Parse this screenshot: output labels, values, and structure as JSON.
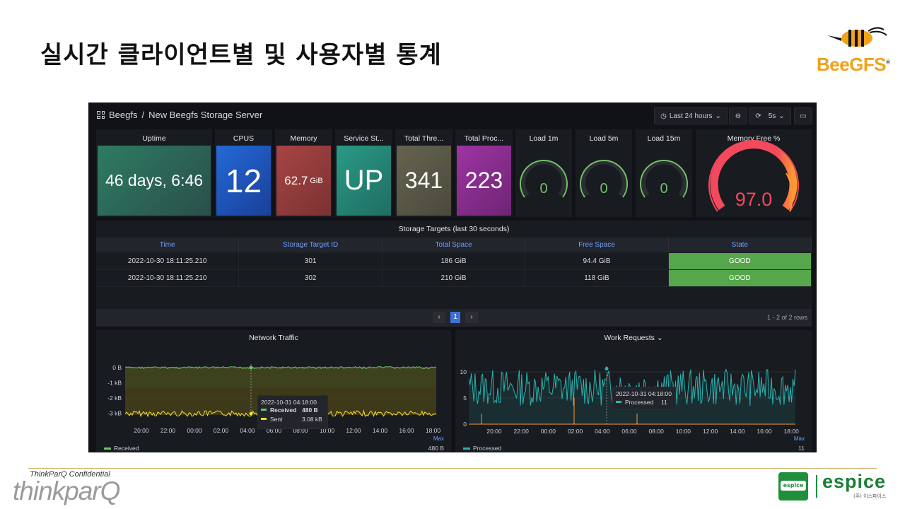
{
  "slide": {
    "title": "실시간 클라이언트별 및 사용자별 통계",
    "brand": "BeeGFS",
    "confidential": "ThinkParQ Confidential",
    "footer_logo": "thinkparQ",
    "partner_badge": "espice",
    "partner_name": "espice",
    "partner_sub": "(주) 이스파이스"
  },
  "dashboard": {
    "breadcrumb_root": "Beegfs",
    "breadcrumb_sep": "/",
    "breadcrumb_page": "New Beegfs Storage Server",
    "time_range": "Last 24 hours",
    "refresh": "5s",
    "icons": [
      "grid-icon",
      "clock-icon",
      "zoom-out-icon",
      "refresh-icon",
      "tv-icon"
    ]
  },
  "stats": [
    {
      "title": "Uptime",
      "value": "46 days, 6:46",
      "color": "#2d6a55"
    },
    {
      "title": "CPUS",
      "value": "12",
      "color": "#1f60c4"
    },
    {
      "title": "Memory",
      "value": "62.7",
      "unit": "GiB",
      "color": "#9a3a3a"
    },
    {
      "title": "Service St...",
      "value": "UP",
      "color": "#248a7a"
    },
    {
      "title": "Total Thre...",
      "value": "341",
      "color": "#5c5a4c"
    },
    {
      "title": "Total Proc...",
      "value": "223",
      "color": "#8e2e93"
    }
  ],
  "gauges": [
    {
      "title": "Load 1m",
      "value": "0",
      "fraction": 0
    },
    {
      "title": "Load 5m",
      "value": "0",
      "fraction": 0
    },
    {
      "title": "Load 15m",
      "value": "0",
      "fraction": 0
    },
    {
      "title": "Memory Free %",
      "value": "97.0",
      "fraction": 0.97
    }
  ],
  "storage_table": {
    "title": "Storage Targets (last 30 seconds)",
    "columns": [
      "Time",
      "Storage Target ID",
      "Total Space",
      "Free Space",
      "State"
    ],
    "rows": [
      [
        "2022-10-30 18:11:25.210",
        "301",
        "186 GiB",
        "94.4 GiB",
        "GOOD"
      ],
      [
        "2022-10-30 18:11:25.210",
        "302",
        "210 GiB",
        "118 GiB",
        "GOOD"
      ]
    ],
    "page": "1",
    "prev": "‹",
    "next": "›",
    "rows_count": "1 - 2 of 2 rows"
  },
  "network_chart": {
    "title": "Network Traffic",
    "y_ticks": [
      "0 B",
      "-1 kB",
      "-2 kB",
      "-3 kB"
    ],
    "x_ticks": [
      "20:00",
      "22:00",
      "00:00",
      "02:00",
      "04:00",
      "06:00",
      "08:00",
      "10:00",
      "12:00",
      "14:00",
      "16:00",
      "18:00"
    ],
    "tooltip_time": "2022-10-31 04:18:00",
    "tooltip_rows": [
      {
        "name": "Received",
        "value": "480 B",
        "color": "#73bf69"
      },
      {
        "name": "Sent",
        "value": "3.08 kB",
        "color": "#fade2a"
      }
    ],
    "legend_header": "Max",
    "legend_name": "Received",
    "legend_value": "480 B"
  },
  "work_chart": {
    "title": "Work Requests",
    "title_suffix": "⌄",
    "y_ticks": [
      "10",
      "5",
      "0"
    ],
    "x_ticks": [
      "20:00",
      "22:00",
      "00:00",
      "02:00",
      "04:00",
      "06:00",
      "08:00",
      "10:00",
      "12:00",
      "14:00",
      "16:00",
      "18:00"
    ],
    "tooltip_time": "2022-10-31 04:18:00",
    "tooltip_name": "Processed",
    "tooltip_value": "11",
    "legend_header": "Max",
    "legend_name": "Processed",
    "legend_value": "11",
    "color": "#2bb3b1"
  }
}
